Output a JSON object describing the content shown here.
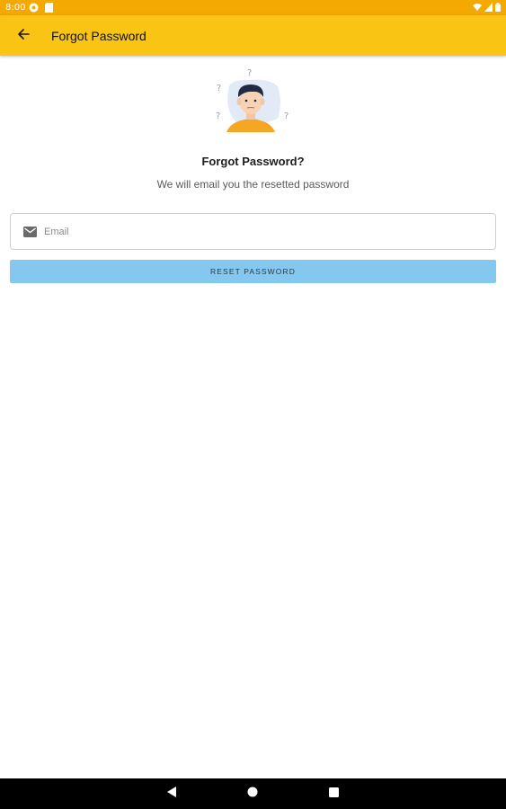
{
  "status_bar": {
    "time": "8:00",
    "icons": [
      "app-circle-icon",
      "sim-icon",
      "wifi-icon",
      "signal-icon",
      "battery-icon"
    ]
  },
  "app_bar": {
    "title": "Forgot Password",
    "back_icon": "arrow-back-icon",
    "background": "#f9c413"
  },
  "content": {
    "heading": "Forgot Password?",
    "subheading": "We will email you the resetted password",
    "email": {
      "placeholder": "Email",
      "value": "",
      "icon": "mail-icon"
    },
    "reset_button": {
      "label": "RESET PASSWORD",
      "color": "#84c8f0"
    }
  },
  "nav_bar": {
    "buttons": [
      "back-triangle-icon",
      "home-circle-icon",
      "recents-square-icon"
    ]
  }
}
